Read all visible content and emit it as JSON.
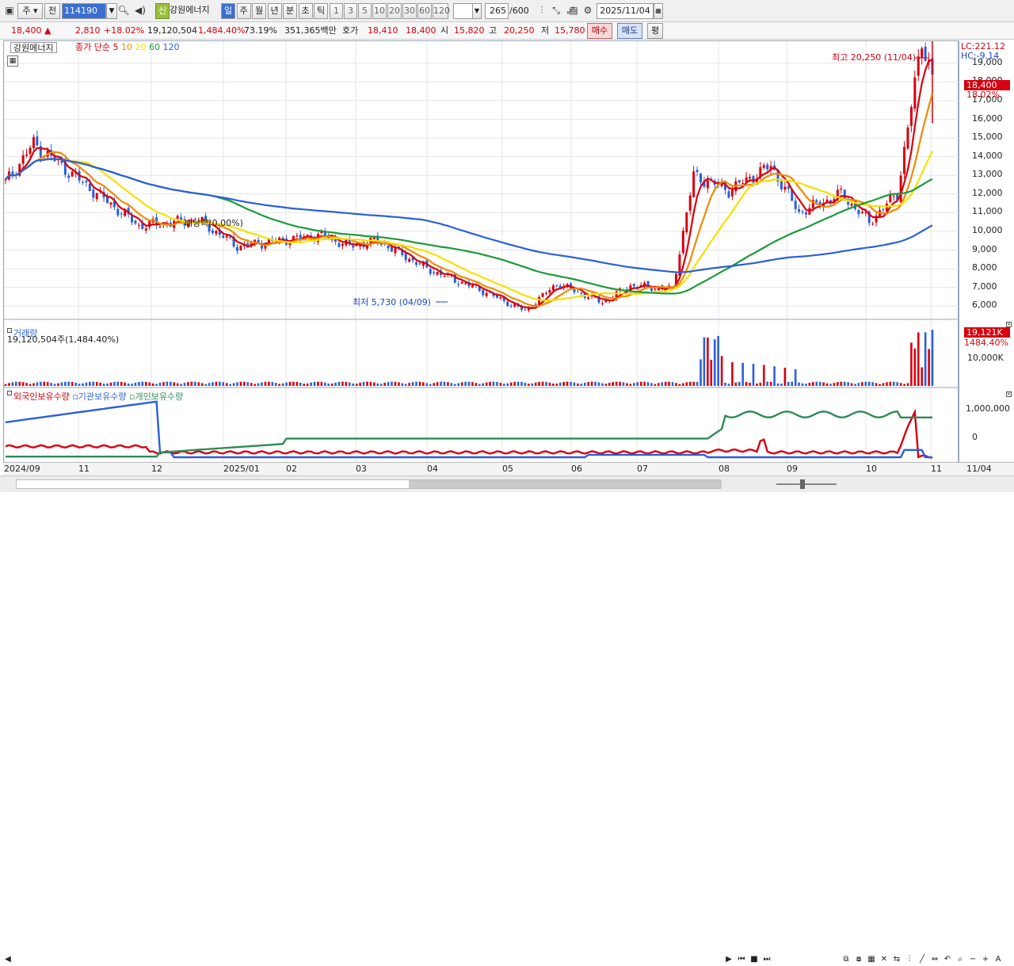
{
  "toolbar": {
    "market_select": "주",
    "prev_label": "전",
    "stock_code": "114190",
    "tag_new": "신",
    "stock_name": "강원에너지",
    "periods": [
      "일",
      "주",
      "월",
      "년",
      "분",
      "초",
      "틱"
    ],
    "period_selected": "일",
    "intervals": [
      "1",
      "3",
      "5",
      "10",
      "20",
      "30",
      "60",
      "120"
    ],
    "count_current": "265",
    "count_total": "/600",
    "date": "2025/11/04"
  },
  "quote": {
    "price": "18,400",
    "change_arrow": "▲",
    "change": "2,810",
    "change_pct": "+18.02%",
    "volume": "19,120,504",
    "volume_pct": "1,484.40%",
    "turnover": "73.19%",
    "amount": "351,365백만",
    "ask_label": "호가",
    "ask": "18,410",
    "bid": "18,400",
    "open_label": "시",
    "open": "15,820",
    "high_label": "고",
    "high": "20,250",
    "low_label": "저",
    "low": "15,780",
    "buy_label": "매수",
    "sell_label": "매도",
    "eval_label": "평"
  },
  "price_panel": {
    "stock_name": "강원에너지",
    "legend_prefix": "종가 단순",
    "ma_labels": [
      "5",
      "10",
      "20",
      "60",
      "120"
    ],
    "ma_colors": [
      "#d7000f",
      "#f08a00",
      "#f5e100",
      "#1d9a3a",
      "#2b5fd9"
    ],
    "high_annotation": "최고 20,250 (11/04)",
    "low_annotation": "최저 5,730 (04/09)",
    "dividend_annotation": "배당락(0.00%)",
    "lc_label": "LC:221.12",
    "hc_label": "HC:-9.14",
    "current_price_tag": "18,400",
    "current_pct_tag": "18.02%",
    "y_ticks": [
      "19,000",
      "18,000",
      "17,000",
      "16,000",
      "15,000",
      "14,000",
      "13,000",
      "12,000",
      "11,000",
      "10,000",
      "9,000",
      "8,000",
      "7,000",
      "6,000"
    ]
  },
  "volume_panel": {
    "title": "거래량",
    "value_text": "19,120,504주(1,484.40%)",
    "tag_value": "19,121K",
    "tag_pct": "1484.40%",
    "y_tick": "10,000K"
  },
  "holding_panel": {
    "series_labels": [
      "외국인보유수량",
      "기관보유수량",
      "개인보유수량"
    ],
    "series_colors": [
      "#d7000f",
      "#2b5fd9",
      "#2e8b57"
    ],
    "y_ticks": [
      "1,000,000",
      "0"
    ]
  },
  "x_axis": {
    "labels": [
      "2024/09",
      "11",
      "12",
      "2025/01",
      "02",
      "03",
      "04",
      "05",
      "06",
      "07",
      "08",
      "09",
      "10",
      "11"
    ],
    "right_label": "11/04"
  },
  "chart_data": {
    "type": "candlestick",
    "title": "강원에너지",
    "x_labels": [
      "2024/09",
      "11",
      "12",
      "2025/01",
      "02",
      "03",
      "04",
      "05",
      "06",
      "07",
      "08",
      "09",
      "10",
      "11"
    ],
    "close_trend_approx": [
      {
        "x": "2024/09",
        "y": 12600
      },
      {
        "x": "2024/09",
        "y": 14700
      },
      {
        "x": "11",
        "y": 12600
      },
      {
        "x": "11",
        "y": 10300
      },
      {
        "x": "12",
        "y": 10600
      },
      {
        "x": "12",
        "y": 9200
      },
      {
        "x": "2025/01",
        "y": 9500
      },
      {
        "x": "02",
        "y": 9800
      },
      {
        "x": "02",
        "y": 9200
      },
      {
        "x": "03",
        "y": 9500
      },
      {
        "x": "03",
        "y": 8000
      },
      {
        "x": "04",
        "y": 6800
      },
      {
        "x": "04",
        "y": 5730
      },
      {
        "x": "05",
        "y": 7200
      },
      {
        "x": "06",
        "y": 6200
      },
      {
        "x": "06",
        "y": 7100
      },
      {
        "x": "07",
        "y": 6900
      },
      {
        "x": "07",
        "y": 13000
      },
      {
        "x": "07",
        "y": 12200
      },
      {
        "x": "08",
        "y": 13500
      },
      {
        "x": "08",
        "y": 11000
      },
      {
        "x": "09",
        "y": 12000
      },
      {
        "x": "10",
        "y": 10500
      },
      {
        "x": "10",
        "y": 12000
      },
      {
        "x": "11",
        "y": 20250
      },
      {
        "x": "11",
        "y": 18400
      }
    ],
    "ylim": [
      5500,
      20500
    ],
    "last_close": 18400,
    "period_high": 20250,
    "period_low": 5730
  }
}
